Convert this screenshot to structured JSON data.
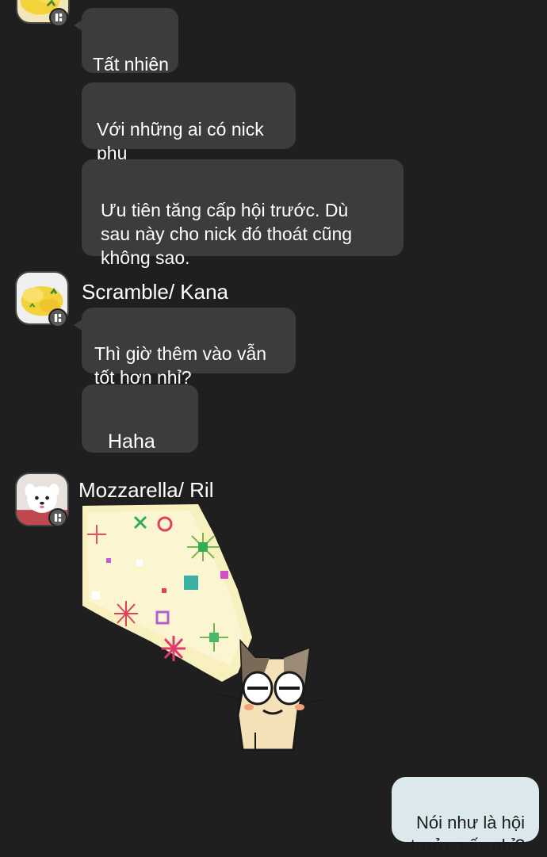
{
  "messages": {
    "m1": "Tất nhiên",
    "m2": "Với những ai có nick\nphụ",
    "m3": "Ưu tiên tăng cấp hội trước. Dù\nsau này cho nick đó thoát cũng\nkhông sao.",
    "m4": "Thì giờ thêm vào vẫn\ntốt hơn nhỉ?",
    "m5": "Haha",
    "out1": "Nói như là hội\ntrưởng ấy nhỉ?"
  },
  "senders": {
    "kana": "Scramble/ Kana",
    "ril": "Mozzarella/ Ril"
  },
  "icons": {
    "avatar_kana": "scrambled-egg-avatar",
    "avatar_ril": "white-dog-avatar",
    "badge": "app-badge-icon",
    "sticker": "cat-with-flashlight-sticker"
  },
  "colors": {
    "background": "#1f1f1f",
    "incoming_bubble": "#3c3c3c",
    "outgoing_bubble": "#dbe8ec"
  }
}
